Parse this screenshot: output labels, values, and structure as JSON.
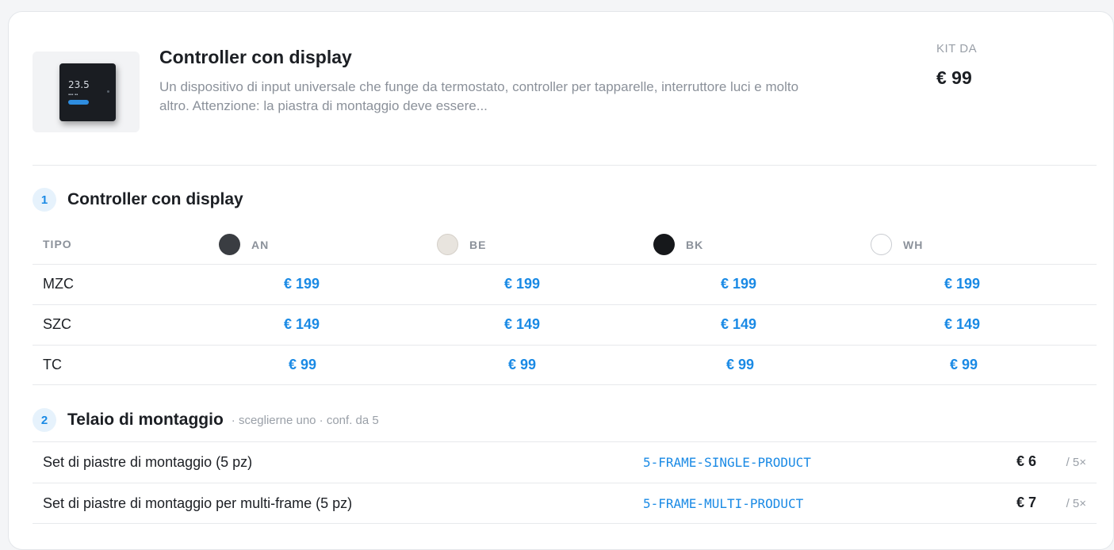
{
  "product": {
    "title": "Controller con display",
    "description": "Un dispositivo di input universale che funge da termostato, controller per tapparelle, interruttore luci e molto altro. Attenzione: la piastra di montaggio deve essere...",
    "price_label": "KIT DA",
    "price_value": "€ 99",
    "thumb_temperature": "23.5"
  },
  "section1": {
    "number": "1",
    "title": "Controller con display",
    "type_header": "TIPO",
    "colors": [
      {
        "code": "AN",
        "swatch": "#3a3d42"
      },
      {
        "code": "BE",
        "swatch": "#e8e4de"
      },
      {
        "code": "BK",
        "swatch": "#16181b"
      },
      {
        "code": "WH",
        "swatch": "#ffffff"
      }
    ],
    "rows": [
      {
        "type": "MZC",
        "prices": [
          "€ 199",
          "€ 199",
          "€ 199",
          "€ 199"
        ]
      },
      {
        "type": "SZC",
        "prices": [
          "€ 149",
          "€ 149",
          "€ 149",
          "€ 149"
        ]
      },
      {
        "type": "TC",
        "prices": [
          "€ 99",
          "€ 99",
          "€ 99",
          "€ 99"
        ]
      }
    ]
  },
  "section2": {
    "number": "2",
    "title": "Telaio di montaggio",
    "note": "· sceglierne uno · conf. da 5",
    "items": [
      {
        "name": "Set di piastre di montaggio (5 pz)",
        "sku": "5-FRAME-SINGLE-PRODUCT",
        "price": "€ 6",
        "qty": "/ 5×"
      },
      {
        "name": "Set di piastre di montaggio per multi-frame (5 pz)",
        "sku": "5-FRAME-MULTI-PRODUCT",
        "price": "€ 7",
        "qty": "/ 5×"
      }
    ]
  },
  "colors": {
    "accent": "#1a8ae5",
    "muted": "#8b919a"
  }
}
